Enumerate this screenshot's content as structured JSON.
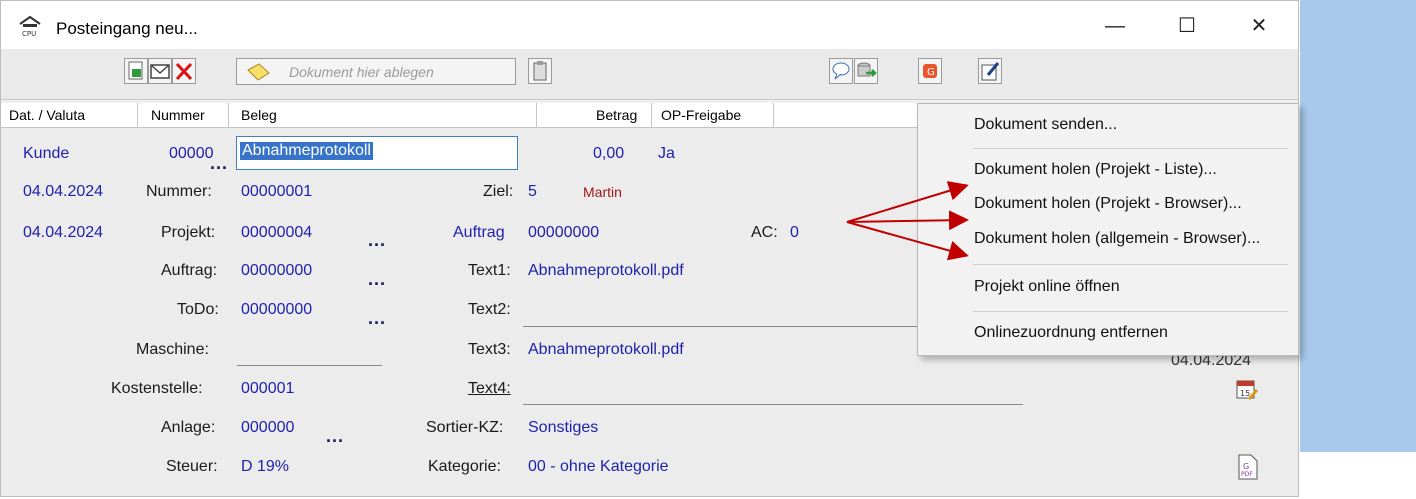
{
  "window": {
    "title": "Posteingang neu...",
    "minimize": "—",
    "maximize": "☐",
    "close": "✕"
  },
  "toolbar": {
    "dropzone_text": "Dokument hier ablegen"
  },
  "columns": [
    {
      "label": "Dat. / Valuta"
    },
    {
      "label": "Nummer"
    },
    {
      "label": "Beleg"
    },
    {
      "label": "Betrag"
    },
    {
      "label": "OP-Freigabe"
    }
  ],
  "row1": {
    "typ": "Kunde",
    "nummer": "00000",
    "beleg": "Abnahmeprotokoll",
    "betrag": "0,00",
    "op": "Ja"
  },
  "row2": {
    "datum": "04.04.2024",
    "nummer_label": "Nummer:",
    "nummer_value": "00000001",
    "ziel_label": "Ziel:",
    "ziel_value": "5",
    "user": "Martin"
  },
  "row3": {
    "datum": "04.04.2024",
    "projekt_label": "Projekt:",
    "projekt_value": "00000004",
    "auftrag_label": "Auftrag",
    "auftrag_value": "00000000",
    "ac_label": "AC:",
    "ac_value": "0"
  },
  "fields": {
    "auftrag_label": "Auftrag:",
    "auftrag_value": "00000000",
    "todo_label": "ToDo:",
    "todo_value": "00000000",
    "maschine_label": "Maschine:",
    "kostenstelle_label": "Kostenstelle:",
    "kostenstelle_value": "000001",
    "anlage_label": "Anlage:",
    "anlage_value": "000000",
    "steuer_label": "Steuer:",
    "steuer_value": "D 19%",
    "text1_label": "Text1:",
    "text1_value": "Abnahmeprotokoll.pdf",
    "text2_label": "Text2:",
    "text3_label": "Text3:",
    "text3_value": "Abnahmeprotokoll.pdf",
    "text4_label": "Text4:",
    "sortier_label": "Sortier-KZ:",
    "sortier_value": "Sonstiges",
    "kategorie_label": "Kategorie:",
    "kategorie_value": "00 - ohne Kategorie",
    "date_partial": "04.04.2024",
    "dots": "..."
  },
  "context_menu": {
    "items": [
      "Dokument senden...",
      "Dokument holen (Projekt - Liste)...",
      "Dokument holen (Projekt - Browser)...",
      "Dokument holen (allgemein - Browser)...",
      "Projekt online öffnen",
      "Onlinezuordnung entfernen"
    ]
  },
  "colors": {
    "accent": "#1f1fae",
    "annotation_arrow": "#c00000",
    "menu_bg": "#f2f2f2"
  }
}
